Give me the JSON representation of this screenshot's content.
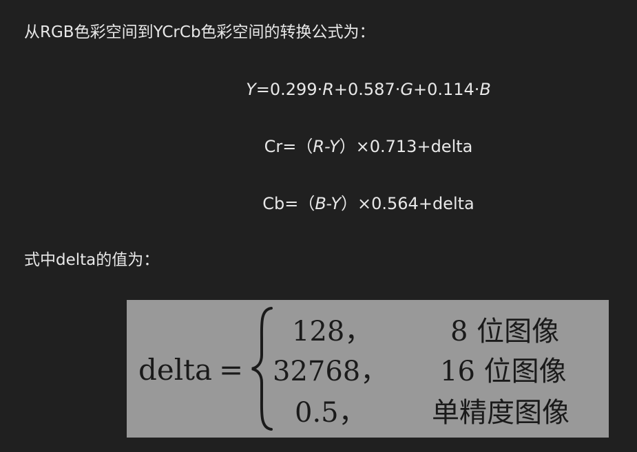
{
  "intro_text": "从RGB色彩空间到YCrCb色彩空间的转换公式为：",
  "formulas": {
    "y": {
      "lhs": "Y",
      "rest": "=0.299·",
      "r": "R",
      "p1": "+0.587·",
      "g": "G",
      "p2": "+0.114·",
      "b": "B"
    },
    "cr": {
      "lhs": "Cr=（",
      "a": "R",
      "dash": "-",
      "y": "Y",
      "rhs": "）×0.713+delta"
    },
    "cb": {
      "lhs": "Cb=（",
      "a": "B",
      "dash": "-",
      "y": "Y",
      "rhs": "）×0.564+delta"
    }
  },
  "delta_intro": "式中delta的值为：",
  "delta_def": {
    "lhs": "delta",
    "eq": "=",
    "cases": [
      {
        "value": "128，",
        "condition": "8 位图像"
      },
      {
        "value": "32768，",
        "condition": "16 位图像"
      },
      {
        "value": "0.5，",
        "condition": "单精度图像"
      }
    ]
  }
}
